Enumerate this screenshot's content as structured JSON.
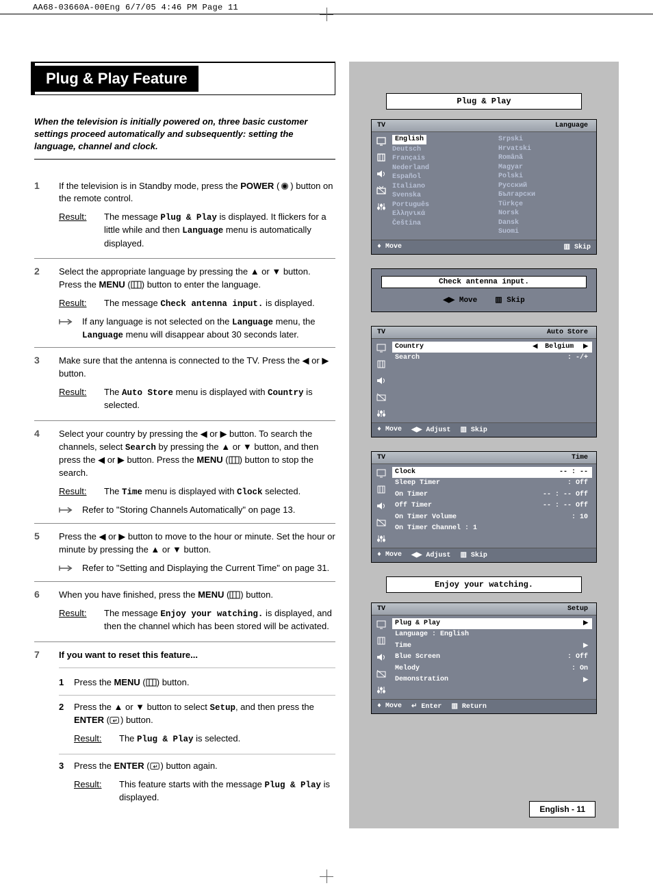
{
  "crop_header": "AA68-03660A-00Eng  6/7/05  4:46 PM  Page 11",
  "title": "Plug & Play Feature",
  "intro": "When the television is initially powered on, three basic customer settings proceed automatically and subsequently: setting the language, channel and clock.",
  "steps": {
    "1": {
      "text_a": "If the television is in Standby mode, press the ",
      "power": "POWER",
      "text_b": " button on the remote control.",
      "result_label": "Result:",
      "result": "The message Plug & Play is displayed. It flickers for a little while and then Language menu is automatically displayed.",
      "tt1": "Plug & Play",
      "tt2": "Language"
    },
    "2": {
      "text": "Select the appropriate language by pressing the ▲ or ▼ button. Press the MENU (",
      "text_b": ") button to enter the language.",
      "result_label": "Result:",
      "result_a": "The message ",
      "tt": "Check antenna input.",
      "result_b": " is displayed.",
      "note": "If any language is not selected on the Language menu, the Language menu will disappear about 30 seconds later.",
      "tt_lang": "Language"
    },
    "3": {
      "text": "Make sure that the antenna is connected to the TV. Press the ◀ or ▶ button.",
      "result_label": "Result:",
      "result_a": "The ",
      "tt1": "Auto Store",
      "result_b": " menu is displayed with ",
      "tt2": "Country",
      "result_c": " is selected."
    },
    "4": {
      "text_a": "Select your country by pressing the ◀ or ▶ button. To search the channels, select ",
      "tt1": "Search",
      "text_b": " by pressing the ▲ or ▼ button, and then press the ◀ or ▶ button. Press the ",
      "menu": "MENU",
      "text_c": ") button to stop the search.",
      "result_label": "Result:",
      "result_a": "The ",
      "tt_time": "Time",
      "result_b": " menu is displayed with ",
      "tt_clock": "Clock",
      "result_c": " selected.",
      "note": "Refer to \"Storing Channels Automatically\" on page 13."
    },
    "5": {
      "text": "Press the ◀ or ▶ button to move to the hour or minute. Set the hour or minute by pressing the ▲ or ▼ button.",
      "note": "Refer to \"Setting and Displaying the Current Time\" on page 31."
    },
    "6": {
      "text_a": "When you have finished, press the ",
      "menu": "MENU",
      "text_b": ") button.",
      "result_label": "Result:",
      "result_a": "The message ",
      "tt": "Enjoy your watching.",
      "result_b": " is displayed, and then the channel which has been stored will be activated."
    },
    "7": {
      "heading": "If you want to reset this feature...",
      "s1_a": "Press the ",
      "menu": "MENU",
      "s1_b": ") button.",
      "s2_a": "Press the ▲ or ▼ button to select ",
      "tt_setup": "Setup",
      "s2_b": ", and then press the ",
      "enter": "ENTER",
      "s2_c": ") button.",
      "s2_result_label": "Result:",
      "s2_result_a": "The ",
      "tt_pp": "Plug & Play",
      "s2_result_b": " is selected.",
      "s3_a": "Press the ",
      "s3_b": ") button again.",
      "s3_result_label": "Result:",
      "s3_result_a": "This feature starts with the message ",
      "s3_result_b": " is displayed."
    }
  },
  "osd": {
    "pp_label": "Plug & Play",
    "lang_title": "Language",
    "tv": "TV",
    "languages_left": [
      "English",
      "Deutsch",
      "Français",
      "Nederland",
      "Español",
      "Italiano",
      "Svenska",
      "Português",
      "Ελληνικά",
      "Čeština"
    ],
    "languages_right": [
      "Srpski",
      "Hrvatski",
      "Română",
      "Magyar",
      "Polski",
      "Русский",
      "Български",
      "Türkçe",
      "Norsk",
      "Dansk",
      "Suomi"
    ],
    "move": "Move",
    "skip": "Skip",
    "adjust": "Adjust",
    "enter": "Enter",
    "return": "Return",
    "check_antenna": "Check antenna input.",
    "auto_store": {
      "title": "Auto Store",
      "country": "Country",
      "country_val": "Belgium",
      "search": "Search",
      "search_val": ": -/+"
    },
    "time": {
      "title": "Time",
      "clock": "Clock",
      "clock_val": "-- : --",
      "sleep": "Sleep Timer",
      "sleep_val": ": Off",
      "ont": "On Timer",
      "ont_val": "-- : -- Off",
      "offt": "Off Timer",
      "offt_val": "-- : -- Off",
      "vol": "On Timer Volume",
      "vol_val": ": 10",
      "ch": "On Timer Channel : 1"
    },
    "enjoy": "Enjoy your watching.",
    "setup": {
      "title": "Setup",
      "pp": "Plug & Play",
      "lang": "Language  : English",
      "time": "Time",
      "blue": "Blue Screen",
      "blue_val": ": Off",
      "melody": "Melody",
      "melody_val": ": On",
      "demo": "Demonstration"
    }
  },
  "page_number": "English - 11"
}
